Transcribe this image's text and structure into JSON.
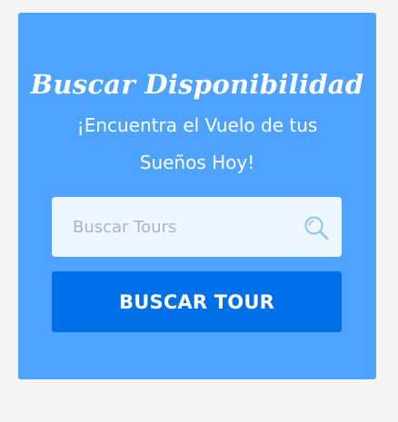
{
  "widget": {
    "title": "Buscar Disponibilidad",
    "subtitle": "¡Encuentra el Vuelo de tus Sueños Hoy!",
    "search": {
      "placeholder": "Buscar Tours",
      "value": "",
      "icon": "search-icon"
    },
    "submit_label": "BUSCAR TOUR"
  },
  "colors": {
    "page_background": "#f5f5f5",
    "card_background": "#4da3ff",
    "input_background": "#eef6ff",
    "button_background": "#0070e8",
    "icon_color": "#8ec3f5",
    "text_light": "#ffffff"
  }
}
